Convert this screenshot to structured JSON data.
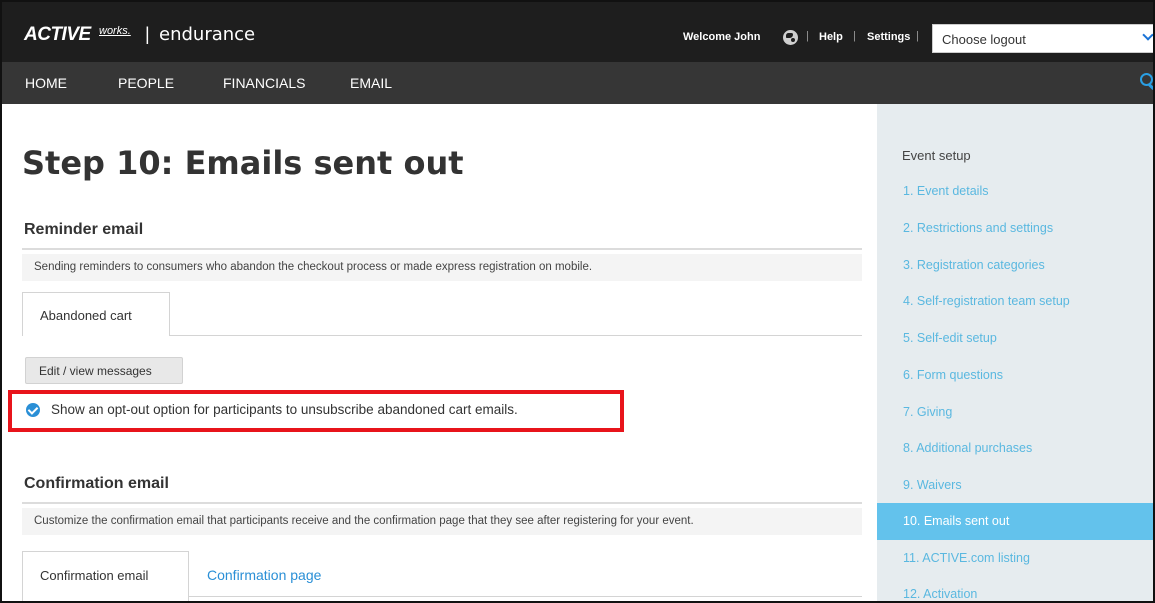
{
  "header": {
    "brand": "ACTIVE",
    "brand_sub": "works.",
    "separator": "|",
    "product": "endurance",
    "welcome": "Welcome John",
    "help": "Help",
    "settings": "Settings",
    "divider": "|",
    "logout_select": "Choose logout"
  },
  "nav": {
    "items": [
      "HOME",
      "PEOPLE",
      "FINANCIALS",
      "EMAIL"
    ]
  },
  "main": {
    "title": "Step 10: Emails sent out",
    "reminder": {
      "title": "Reminder email",
      "description": "Sending reminders to consumers who abandon the checkout process or made express registration on mobile.",
      "tab": "Abandoned cart",
      "button": "Edit / view messages",
      "checkbox_label": "Show an opt-out option for participants to unsubscribe abandoned cart emails.",
      "checkbox_checked": true
    },
    "confirmation": {
      "title": "Confirmation email",
      "description": "Customize the confirmation email that participants receive and the confirmation page that they see after registering for your event.",
      "tabs": [
        "Confirmation email",
        "Confirmation page"
      ]
    }
  },
  "sidebar": {
    "heading": "Event setup",
    "items": [
      "1. Event details",
      "2. Restrictions and settings",
      "3. Registration categories",
      "4. Self-registration team setup",
      "5. Self-edit setup",
      "6. Form questions",
      "7. Giving",
      "8. Additional purchases",
      "9. Waivers",
      "10. Emails sent out",
      "11. ACTIVE.com listing",
      "12. Activation"
    ],
    "active_index": 9
  },
  "colors": {
    "topbar": "#1e1e1e",
    "navbar": "#363636",
    "accent": "#2a8fd6",
    "sidebar_bg": "#e6ecef",
    "sidebar_active": "#63c2ec",
    "highlight": "#e8141b"
  }
}
